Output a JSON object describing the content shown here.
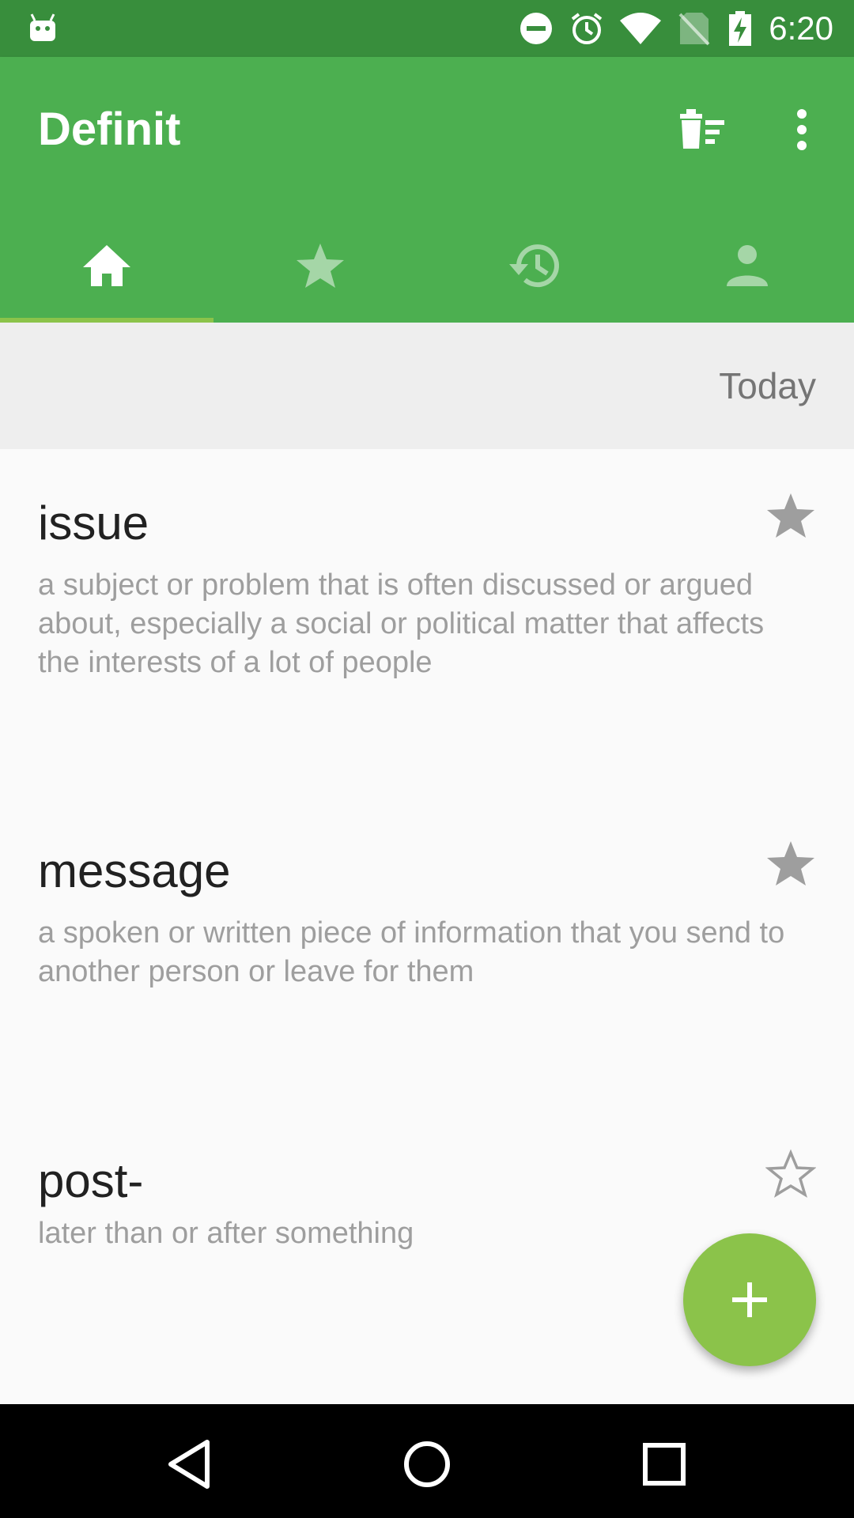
{
  "status_bar": {
    "time": "6:20",
    "icons": [
      "android-icon",
      "do-not-disturb-icon",
      "alarm-icon",
      "wifi-icon",
      "no-sim-icon",
      "battery-charging-icon"
    ]
  },
  "app_bar": {
    "title": "Definit",
    "actions": [
      "clear-list-icon",
      "more-vert-icon"
    ]
  },
  "tabs": [
    {
      "icon": "home-icon",
      "selected": true
    },
    {
      "icon": "star-icon",
      "selected": false
    },
    {
      "icon": "history-icon",
      "selected": false
    },
    {
      "icon": "person-icon",
      "selected": false
    }
  ],
  "section": {
    "label": "Today"
  },
  "words": [
    {
      "word": "issue",
      "definition": "a subject or problem that is often discussed or argued about, especially a social or political matter that affects the interests of a lot of people",
      "starred": true
    },
    {
      "word": "message",
      "definition": "a spoken or written piece of information that you send to another person or leave for them",
      "starred": true
    },
    {
      "word": "post-",
      "definition": "later than or after something",
      "starred": false
    }
  ],
  "fab": {
    "icon": "add-icon"
  },
  "nav_bar": {
    "buttons": [
      "back-icon",
      "home-circle-icon",
      "recents-icon"
    ]
  },
  "colors": {
    "status_bar": "#388e3c",
    "primary": "#4caf50",
    "accent": "#8bc34a",
    "star_gray": "#9e9e9e"
  }
}
